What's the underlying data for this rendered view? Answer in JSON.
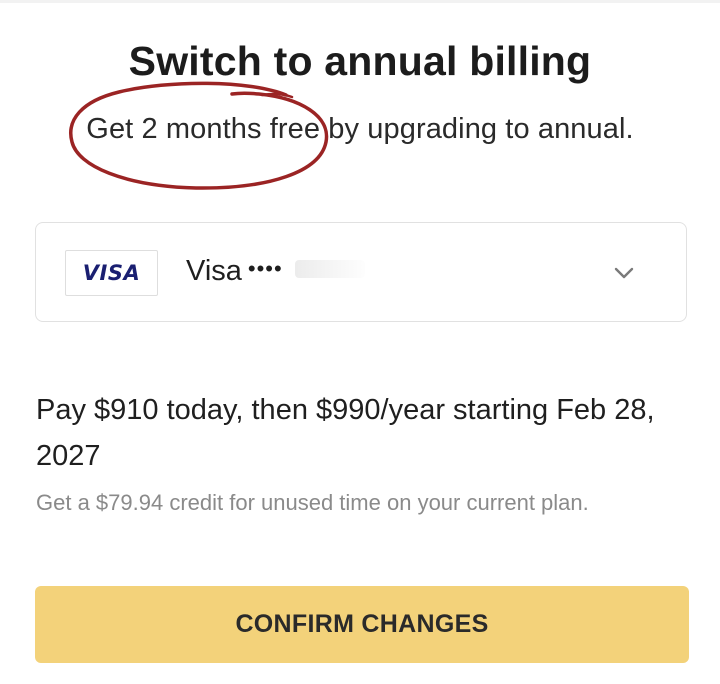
{
  "dialog": {
    "title": "Switch to annual billing",
    "subtitle": "Get 2 months free by upgrading to annual."
  },
  "payment_method": {
    "brand_logo_text": "VISA",
    "brand_name": "Visa",
    "masked_number": "••••",
    "chevron_icon": "chevron-down-icon",
    "brand_color": "#1a1f71"
  },
  "summary": {
    "pay_text": "Pay $910 today, then $990/year starting Feb 28, 2027",
    "credit_text": "Get a $79.94 credit for unused time on your current plan."
  },
  "actions": {
    "confirm_label": "CONFIRM CHANGES",
    "confirm_color": "#f3d27a"
  },
  "annotation": {
    "circle_color": "#9b2424"
  }
}
